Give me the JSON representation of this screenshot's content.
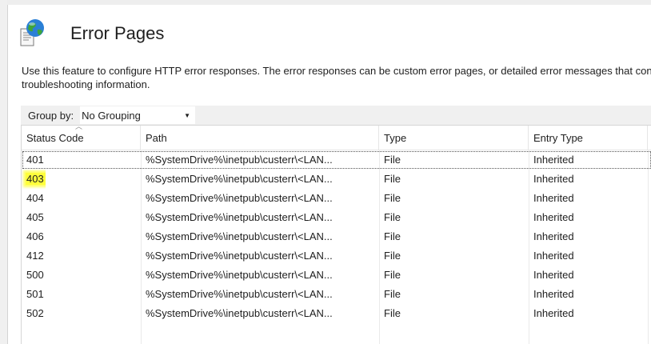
{
  "page": {
    "title": "Error Pages",
    "description_line1": "Use this feature to configure HTTP error responses. The error responses can be custom error pages, or detailed error messages that contain",
    "description_line2": "troubleshooting information."
  },
  "toolbar": {
    "group_by_label": "Group by:",
    "group_by_value": "No Grouping"
  },
  "table": {
    "columns": [
      "Status Code",
      "Path",
      "Type",
      "Entry Type"
    ],
    "rows": [
      {
        "status": "401",
        "path": "%SystemDrive%\\inetpub\\custerr\\<LAN...",
        "type": "File",
        "entry": "Inherited"
      },
      {
        "status": "403",
        "path": "%SystemDrive%\\inetpub\\custerr\\<LAN...",
        "type": "File",
        "entry": "Inherited"
      },
      {
        "status": "404",
        "path": "%SystemDrive%\\inetpub\\custerr\\<LAN...",
        "type": "File",
        "entry": "Inherited"
      },
      {
        "status": "405",
        "path": "%SystemDrive%\\inetpub\\custerr\\<LAN...",
        "type": "File",
        "entry": "Inherited"
      },
      {
        "status": "406",
        "path": "%SystemDrive%\\inetpub\\custerr\\<LAN...",
        "type": "File",
        "entry": "Inherited"
      },
      {
        "status": "412",
        "path": "%SystemDrive%\\inetpub\\custerr\\<LAN...",
        "type": "File",
        "entry": "Inherited"
      },
      {
        "status": "500",
        "path": "%SystemDrive%\\inetpub\\custerr\\<LAN...",
        "type": "File",
        "entry": "Inherited"
      },
      {
        "status": "501",
        "path": "%SystemDrive%\\inetpub\\custerr\\<LAN...",
        "type": "File",
        "entry": "Inherited"
      },
      {
        "status": "502",
        "path": "%SystemDrive%\\inetpub\\custerr\\<LAN...",
        "type": "File",
        "entry": "Inherited"
      }
    ]
  },
  "colors": {
    "highlight": "#ffff3c",
    "grid_line": "#eaeaea"
  },
  "icons": {
    "feature": "error-pages-icon",
    "dropdown": "chevron-down-icon",
    "sort": "sort-caret-icon"
  }
}
